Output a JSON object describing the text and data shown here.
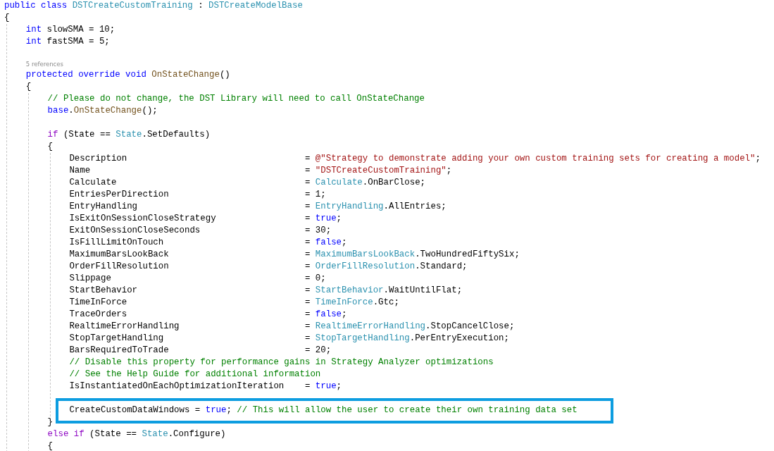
{
  "code_lines": [
    {
      "kind": "code",
      "tokens": [
        {
          "kind": "keyword",
          "text": "public class "
        },
        {
          "kind": "type",
          "text": "DSTCreateCustomTraining"
        },
        {
          "kind": "plain",
          "text": " : "
        },
        {
          "kind": "type",
          "text": "DSTCreateModelBase"
        }
      ]
    },
    {
      "kind": "code",
      "tokens": [
        {
          "kind": "plain",
          "text": "{"
        }
      ],
      "children": [
        {
          "kind": "code",
          "tokens": [
            {
              "kind": "keyword",
              "text": "int"
            },
            {
              "kind": "plain",
              "text": " slowSMA = 10;"
            }
          ]
        },
        {
          "kind": "code",
          "tokens": [
            {
              "kind": "keyword",
              "text": "int"
            },
            {
              "kind": "plain",
              "text": " fastSMA = 5;"
            }
          ]
        },
        {
          "kind": "blank"
        },
        {
          "kind": "codelens",
          "text": "5 references"
        },
        {
          "kind": "code",
          "tokens": [
            {
              "kind": "keyword",
              "text": "protected override void "
            },
            {
              "kind": "method",
              "text": "OnStateChange"
            },
            {
              "kind": "plain",
              "text": "()"
            }
          ]
        },
        {
          "kind": "code",
          "tokens": [
            {
              "kind": "plain",
              "text": "{"
            }
          ],
          "children": [
            {
              "kind": "code",
              "tokens": [
                {
                  "kind": "comment",
                  "text": "// Please do not change, the DST Library will need to call OnStateChange"
                }
              ]
            },
            {
              "kind": "code",
              "tokens": [
                {
                  "kind": "keyword",
                  "text": "base"
                },
                {
                  "kind": "plain",
                  "text": "."
                },
                {
                  "kind": "method",
                  "text": "OnStateChange"
                },
                {
                  "kind": "plain",
                  "text": "();"
                }
              ]
            },
            {
              "kind": "blank"
            },
            {
              "kind": "code",
              "tokens": [
                {
                  "kind": "control",
                  "text": "if"
                },
                {
                  "kind": "plain",
                  "text": " (State == "
                },
                {
                  "kind": "type",
                  "text": "State"
                },
                {
                  "kind": "plain",
                  "text": ".SetDefaults)"
                }
              ]
            },
            {
              "kind": "code",
              "tokens": [
                {
                  "kind": "plain",
                  "text": "{"
                }
              ],
              "children": [
                {
                  "kind": "assign",
                  "name": "Description",
                  "tokens": [
                    {
                      "kind": "plain",
                      "text": "= "
                    },
                    {
                      "kind": "string",
                      "text": "@\"Strategy to demonstrate adding your own custom training sets for creating a model\""
                    },
                    {
                      "kind": "plain",
                      "text": ";"
                    }
                  ]
                },
                {
                  "kind": "assign",
                  "name": "Name",
                  "tokens": [
                    {
                      "kind": "plain",
                      "text": "= "
                    },
                    {
                      "kind": "string",
                      "text": "\"DSTCreateCustomTraining\""
                    },
                    {
                      "kind": "plain",
                      "text": ";"
                    }
                  ]
                },
                {
                  "kind": "assign",
                  "name": "Calculate",
                  "tokens": [
                    {
                      "kind": "plain",
                      "text": "= "
                    },
                    {
                      "kind": "type",
                      "text": "Calculate"
                    },
                    {
                      "kind": "plain",
                      "text": ".OnBarClose;"
                    }
                  ]
                },
                {
                  "kind": "assign",
                  "name": "EntriesPerDirection",
                  "tokens": [
                    {
                      "kind": "plain",
                      "text": "= 1;"
                    }
                  ]
                },
                {
                  "kind": "assign",
                  "name": "EntryHandling",
                  "tokens": [
                    {
                      "kind": "plain",
                      "text": "= "
                    },
                    {
                      "kind": "type",
                      "text": "EntryHandling"
                    },
                    {
                      "kind": "plain",
                      "text": ".AllEntries;"
                    }
                  ]
                },
                {
                  "kind": "assign",
                  "name": "IsExitOnSessionCloseStrategy",
                  "tokens": [
                    {
                      "kind": "plain",
                      "text": "= "
                    },
                    {
                      "kind": "keyword",
                      "text": "true"
                    },
                    {
                      "kind": "plain",
                      "text": ";"
                    }
                  ]
                },
                {
                  "kind": "assign",
                  "name": "ExitOnSessionCloseSeconds",
                  "tokens": [
                    {
                      "kind": "plain",
                      "text": "= 30;"
                    }
                  ]
                },
                {
                  "kind": "assign",
                  "name": "IsFillLimitOnTouch",
                  "tokens": [
                    {
                      "kind": "plain",
                      "text": "= "
                    },
                    {
                      "kind": "keyword",
                      "text": "false"
                    },
                    {
                      "kind": "plain",
                      "text": ";"
                    }
                  ]
                },
                {
                  "kind": "assign",
                  "name": "MaximumBarsLookBack",
                  "tokens": [
                    {
                      "kind": "plain",
                      "text": "= "
                    },
                    {
                      "kind": "type",
                      "text": "MaximumBarsLookBack"
                    },
                    {
                      "kind": "plain",
                      "text": ".TwoHundredFiftySix;"
                    }
                  ]
                },
                {
                  "kind": "assign",
                  "name": "OrderFillResolution",
                  "tokens": [
                    {
                      "kind": "plain",
                      "text": "= "
                    },
                    {
                      "kind": "type",
                      "text": "OrderFillResolution"
                    },
                    {
                      "kind": "plain",
                      "text": ".Standard;"
                    }
                  ]
                },
                {
                  "kind": "assign",
                  "name": "Slippage",
                  "tokens": [
                    {
                      "kind": "plain",
                      "text": "= 0;"
                    }
                  ]
                },
                {
                  "kind": "assign",
                  "name": "StartBehavior",
                  "tokens": [
                    {
                      "kind": "plain",
                      "text": "= "
                    },
                    {
                      "kind": "type",
                      "text": "StartBehavior"
                    },
                    {
                      "kind": "plain",
                      "text": ".WaitUntilFlat;"
                    }
                  ]
                },
                {
                  "kind": "assign",
                  "name": "TimeInForce",
                  "tokens": [
                    {
                      "kind": "plain",
                      "text": "= "
                    },
                    {
                      "kind": "type",
                      "text": "TimeInForce"
                    },
                    {
                      "kind": "plain",
                      "text": ".Gtc;"
                    }
                  ]
                },
                {
                  "kind": "assign",
                  "name": "TraceOrders",
                  "tokens": [
                    {
                      "kind": "plain",
                      "text": "= "
                    },
                    {
                      "kind": "keyword",
                      "text": "false"
                    },
                    {
                      "kind": "plain",
                      "text": ";"
                    }
                  ]
                },
                {
                  "kind": "assign",
                  "name": "RealtimeErrorHandling",
                  "tokens": [
                    {
                      "kind": "plain",
                      "text": "= "
                    },
                    {
                      "kind": "type",
                      "text": "RealtimeErrorHandling"
                    },
                    {
                      "kind": "plain",
                      "text": ".StopCancelClose;"
                    }
                  ]
                },
                {
                  "kind": "assign",
                  "name": "StopTargetHandling",
                  "tokens": [
                    {
                      "kind": "plain",
                      "text": "= "
                    },
                    {
                      "kind": "type",
                      "text": "StopTargetHandling"
                    },
                    {
                      "kind": "plain",
                      "text": ".PerEntryExecution;"
                    }
                  ]
                },
                {
                  "kind": "assign",
                  "name": "BarsRequiredToTrade",
                  "tokens": [
                    {
                      "kind": "plain",
                      "text": "= 20;"
                    }
                  ]
                },
                {
                  "kind": "code",
                  "tokens": [
                    {
                      "kind": "comment",
                      "text": "// Disable this property for performance gains in Strategy Analyzer optimizations"
                    }
                  ]
                },
                {
                  "kind": "code",
                  "tokens": [
                    {
                      "kind": "comment",
                      "text": "// See the Help Guide for additional information"
                    }
                  ]
                },
                {
                  "kind": "assign",
                  "name": "IsInstantiatedOnEachOptimizationIteration",
                  "tokens": [
                    {
                      "kind": "plain",
                      "text": "= "
                    },
                    {
                      "kind": "keyword",
                      "text": "true"
                    },
                    {
                      "kind": "plain",
                      "text": ";"
                    }
                  ]
                },
                {
                  "kind": "blank"
                },
                {
                  "kind": "code",
                  "highlighted": true,
                  "tokens": [
                    {
                      "kind": "plain",
                      "text": "CreateCustomDataWindows = "
                    },
                    {
                      "kind": "keyword",
                      "text": "true"
                    },
                    {
                      "kind": "plain",
                      "text": "; "
                    },
                    {
                      "kind": "comment",
                      "text": "// This will allow the user to create their own training data set"
                    }
                  ]
                }
              ]
            },
            {
              "kind": "code",
              "tokens": [
                {
                  "kind": "plain",
                  "text": "}"
                }
              ]
            },
            {
              "kind": "code",
              "tokens": [
                {
                  "kind": "control",
                  "text": "else if"
                },
                {
                  "kind": "plain",
                  "text": " (State == "
                },
                {
                  "kind": "type",
                  "text": "State"
                },
                {
                  "kind": "plain",
                  "text": ".Configure)"
                }
              ]
            },
            {
              "kind": "code",
              "tokens": [
                {
                  "kind": "plain",
                  "text": "{"
                }
              ]
            }
          ]
        }
      ]
    }
  ]
}
